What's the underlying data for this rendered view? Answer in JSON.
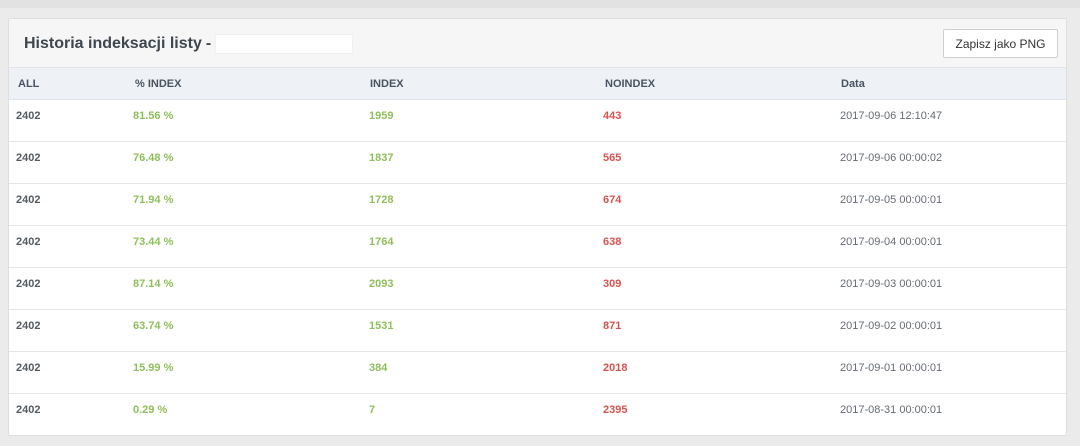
{
  "panel": {
    "title": "Historia indeksacji listy",
    "title_dash": "-",
    "save_button": "Zapisz jako PNG"
  },
  "table": {
    "headers": [
      "ALL",
      "% INDEX",
      "INDEX",
      "NOINDEX",
      "Data"
    ],
    "rows": [
      {
        "all": "2402",
        "pct": "81.56 %",
        "index": "1959",
        "noindex": "443",
        "date": "2017-09-06 12:10:47"
      },
      {
        "all": "2402",
        "pct": "76.48 %",
        "index": "1837",
        "noindex": "565",
        "date": "2017-09-06 00:00:02"
      },
      {
        "all": "2402",
        "pct": "71.94 %",
        "index": "1728",
        "noindex": "674",
        "date": "2017-09-05 00:00:01"
      },
      {
        "all": "2402",
        "pct": "73.44 %",
        "index": "1764",
        "noindex": "638",
        "date": "2017-09-04 00:00:01"
      },
      {
        "all": "2402",
        "pct": "87.14 %",
        "index": "2093",
        "noindex": "309",
        "date": "2017-09-03 00:00:01"
      },
      {
        "all": "2402",
        "pct": "63.74 %",
        "index": "1531",
        "noindex": "871",
        "date": "2017-09-02 00:00:01"
      },
      {
        "all": "2402",
        "pct": "15.99 %",
        "index": "384",
        "noindex": "2018",
        "date": "2017-09-01 00:00:01"
      },
      {
        "all": "2402",
        "pct": "0.29 %",
        "index": "7",
        "noindex": "2395",
        "date": "2017-08-31 00:00:01"
      }
    ]
  },
  "colors": {
    "index_green": "#8fbf5a",
    "noindex_red": "#d9534f"
  }
}
